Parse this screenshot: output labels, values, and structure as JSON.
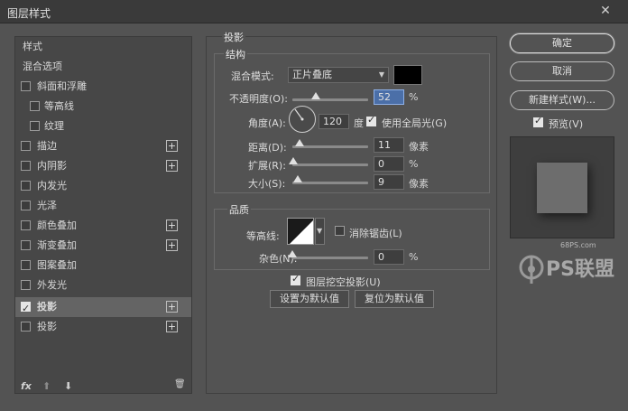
{
  "window": {
    "title": "图层样式",
    "close": "✕"
  },
  "sidebar": {
    "items": [
      {
        "label": "样式"
      },
      {
        "label": "混合选项"
      },
      {
        "label": "斜面和浮雕",
        "checked": false
      },
      {
        "label": "等高线",
        "checked": false
      },
      {
        "label": "纹理",
        "checked": false
      },
      {
        "label": "描边",
        "checked": false
      },
      {
        "label": "内阴影",
        "checked": false
      },
      {
        "label": "内发光",
        "checked": false
      },
      {
        "label": "光泽",
        "checked": false
      },
      {
        "label": "颜色叠加",
        "checked": false
      },
      {
        "label": "渐变叠加",
        "checked": false
      },
      {
        "label": "图案叠加",
        "checked": false
      },
      {
        "label": "外发光",
        "checked": false
      },
      {
        "label": "投影",
        "checked": true
      },
      {
        "label": "投影",
        "checked": false
      }
    ],
    "add_symbol": "+",
    "bottom": {
      "fx": "fx",
      "up": "⬆",
      "down": "⬇",
      "trash": "🗑"
    }
  },
  "drop_shadow": {
    "title": "投影",
    "structure": {
      "title": "结构",
      "blend_mode_label": "混合模式:",
      "blend_mode_value": "正片叠底",
      "opacity_label": "不透明度(O):",
      "opacity_value": "52",
      "opacity_unit": "%",
      "angle_label": "角度(A):",
      "angle_value": "120",
      "angle_unit": "度",
      "global_light_label": "使用全局光(G)",
      "global_light_checked": true,
      "distance_label": "距离(D):",
      "distance_value": "11",
      "distance_unit": "像素",
      "spread_label": "扩展(R):",
      "spread_value": "0",
      "spread_unit": "%",
      "size_label": "大小(S):",
      "size_value": "9",
      "size_unit": "像素"
    },
    "quality": {
      "title": "品质",
      "contour_label": "等高线:",
      "antialias_label": "消除锯齿(L)",
      "antialias_checked": false,
      "noise_label": "杂色(N):",
      "noise_value": "0",
      "noise_unit": "%"
    },
    "knockout_label": "图层挖空投影(U)",
    "knockout_checked": true,
    "make_default": "设置为默认值",
    "reset_default": "复位为默认值"
  },
  "buttons": {
    "ok": "确定",
    "cancel": "取消",
    "new_style": "新建样式(W)...",
    "preview_label": "预览(V)",
    "preview_checked": true
  },
  "watermark": {
    "site": "68PS.com",
    "brand": "PS联盟"
  },
  "colors": {
    "shadow_color": "#000000",
    "selection_bg": "#646464",
    "focus_field": "#4b6fa8"
  }
}
